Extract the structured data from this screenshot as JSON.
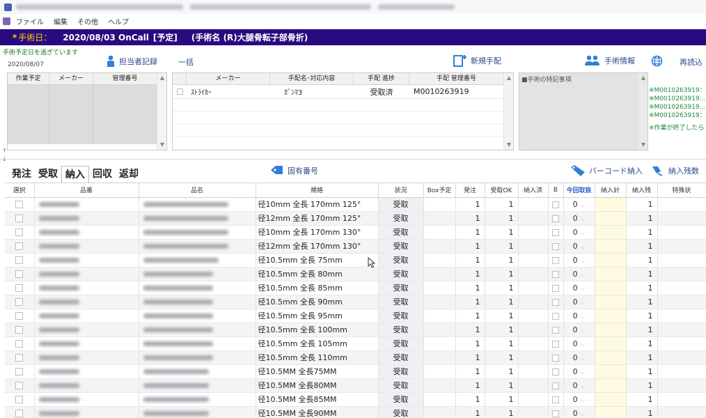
{
  "menu": [
    "ファイル",
    "編集",
    "その他",
    "ヘルプ"
  ],
  "header": {
    "surgery_date_label": "手術日：",
    "surgery_date": "2020/08/03 OnCall",
    "status": "[予定]",
    "procedure": "(手術名 (R)大腿骨転子部骨折)"
  },
  "upper": {
    "warning": "手術予定日を過ぎています",
    "date": "2020/08/07",
    "staff_record_btn": "担当者記録",
    "bulk_btn": "一括",
    "new_order_btn": "新規手配",
    "surgery_info_btn": "手術情報",
    "reload_btn": "再読込"
  },
  "work_grid": {
    "columns": [
      "作業予定",
      "メーカー",
      "管理番号"
    ]
  },
  "order_grid": {
    "columns": [
      "",
      "メーカー",
      "手配名･対応内容",
      "手配 進捗",
      "手配 管理番号"
    ],
    "rows": [
      {
        "maker": "ｽﾄﾗｲｶｰ",
        "name": "ｶﾞﾝﾏ3",
        "progress": "受取済",
        "mgmt_no": "M0010263919"
      }
    ]
  },
  "notes": {
    "title": "■手術の特記事項",
    "side_lines": [
      "※M0010263919：",
      "※M0010263919...",
      "※M0010263919...",
      "※M0010263919：",
      "※作業が終了したら"
    ]
  },
  "tabs": [
    "発注",
    "受取",
    "納入",
    "回収",
    "返却"
  ],
  "active_tab": "納入",
  "mid_buttons": {
    "unique_no": "固有番号",
    "barcode_delivery": "バーコード納入",
    "remaining_delivery": "納入残数"
  },
  "main_grid": {
    "columns": [
      "選択",
      "品番",
      "品名",
      "規格",
      "状況",
      "Box予定",
      "発注",
      "受取OK",
      "納入済",
      "B",
      "今回取扱",
      "納入計",
      "納入残",
      "特殊状"
    ],
    "rows": [
      {
        "spec": "径10mm 全長 170mm 125°",
        "status": "受取",
        "order": "1",
        "recv_ok": "1",
        "current": "0",
        "remain": "1"
      },
      {
        "spec": "径12mm 全長 170mm 125°",
        "status": "受取",
        "order": "1",
        "recv_ok": "1",
        "current": "0",
        "remain": "1"
      },
      {
        "spec": "径10mm 全長 170mm 130°",
        "status": "受取",
        "order": "1",
        "recv_ok": "1",
        "current": "0",
        "remain": "1"
      },
      {
        "spec": "径12mm 全長 170mm 130°",
        "status": "受取",
        "order": "1",
        "recv_ok": "1",
        "current": "0",
        "remain": "1"
      },
      {
        "spec": "径10.5mm 全長 75mm",
        "status": "受取",
        "order": "1",
        "recv_ok": "1",
        "current": "0",
        "remain": "1"
      },
      {
        "spec": "径10.5mm 全長 80mm",
        "status": "受取",
        "order": "1",
        "recv_ok": "1",
        "current": "0",
        "remain": "1"
      },
      {
        "spec": "径10.5mm 全長 85mm",
        "status": "受取",
        "order": "1",
        "recv_ok": "1",
        "current": "0",
        "remain": "1"
      },
      {
        "spec": "径10.5mm 全長 90mm",
        "status": "受取",
        "order": "1",
        "recv_ok": "1",
        "current": "0",
        "remain": "1"
      },
      {
        "spec": "径10.5mm 全長 95mm",
        "status": "受取",
        "order": "1",
        "recv_ok": "1",
        "current": "0",
        "remain": "1"
      },
      {
        "spec": "径10.5mm 全長 100mm",
        "status": "受取",
        "order": "1",
        "recv_ok": "1",
        "current": "0",
        "remain": "1"
      },
      {
        "spec": "径10.5mm 全長 105mm",
        "status": "受取",
        "order": "1",
        "recv_ok": "1",
        "current": "0",
        "remain": "1"
      },
      {
        "spec": "径10.5mm 全長 110mm",
        "status": "受取",
        "order": "1",
        "recv_ok": "1",
        "current": "0",
        "remain": "1"
      },
      {
        "spec": "径10.5MM 全長75MM",
        "status": "受取",
        "order": "1",
        "recv_ok": "1",
        "current": "0",
        "remain": "1"
      },
      {
        "spec": "径10.5MM 全長80MM",
        "status": "受取",
        "order": "1",
        "recv_ok": "1",
        "current": "0",
        "remain": "1"
      },
      {
        "spec": "径10.5MM 全長85MM",
        "status": "受取",
        "order": "1",
        "recv_ok": "1",
        "current": "0",
        "remain": "1"
      },
      {
        "spec": "径10.5MM 全長90MM",
        "status": "受取",
        "order": "1",
        "recv_ok": "1",
        "current": "0",
        "remain": "1"
      }
    ]
  },
  "colors": {
    "header_bg": "#2a0a7f",
    "header_label": "#ffd400",
    "warning_text": "#1c7a2a",
    "accent_blue": "#2b62c8",
    "sum_bg": "#fffbe0"
  }
}
